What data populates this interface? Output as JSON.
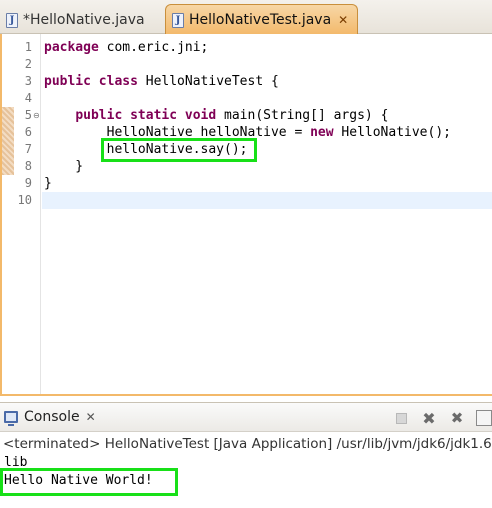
{
  "editor": {
    "tabs": [
      {
        "label": "*HelloNative.java",
        "active": false
      },
      {
        "label": "HelloNativeTest.java",
        "active": true
      }
    ],
    "line_numbers": [
      "1",
      "2",
      "3",
      "4",
      "5",
      "6",
      "7",
      "8",
      "9",
      "10"
    ],
    "lines": {
      "l1_kw": "package",
      "l1_rest": " com.eric.jni;",
      "l3_kw": "public class",
      "l3_rest": " HelloNativeTest {",
      "l5_indent": "    ",
      "l5_kw": "public static void",
      "l5_rest": " main(String[] args) {",
      "l6_pre": "        HelloNative helloNative = ",
      "l6_kw": "new",
      "l6_rest": " HelloNative();",
      "l7": "        helloNative.say();",
      "l8": "    }",
      "l9": "}"
    },
    "fold_marker": "⊖"
  },
  "console": {
    "tab_label": "Console",
    "terminated_text": "<terminated> HelloNativeTest [Java Application] /usr/lib/jvm/jdk6/jdk1.6",
    "output_lines": [
      "lib",
      "Hello Native World!"
    ]
  },
  "colors": {
    "keyword": "#7f0055",
    "highlight_box": "#18e018",
    "active_tab": "#f3b96a",
    "current_line": "#e8f2fe"
  }
}
